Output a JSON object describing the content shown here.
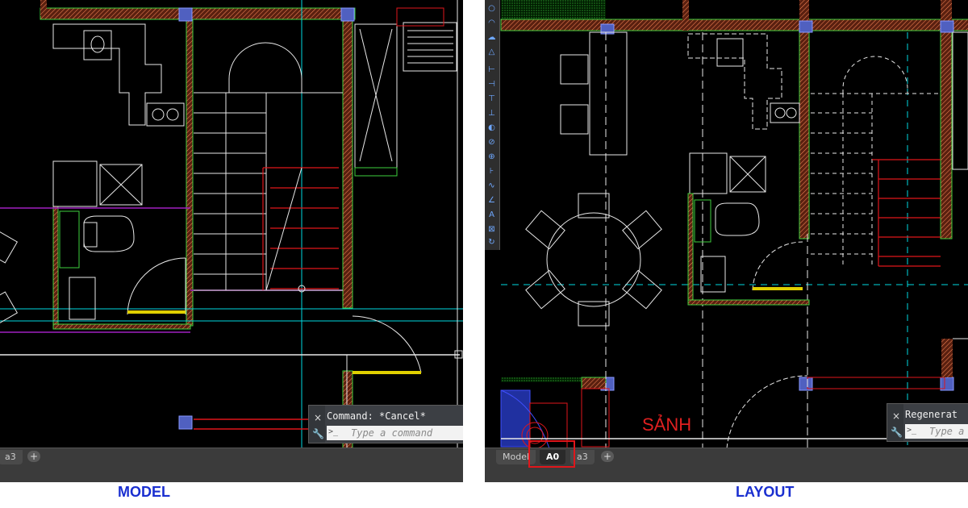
{
  "captions": {
    "model": "MODEL",
    "layout": "LAYOUT"
  },
  "model_panel": {
    "tabs": [
      {
        "label": "a3"
      }
    ],
    "add_tab": "+",
    "command": {
      "history": "Command: *Cancel*",
      "placeholder": "Type a command",
      "close_icon": "×",
      "settings_icon": "🔧",
      "prompt_icon": ">_"
    }
  },
  "layout_panel": {
    "tabs": [
      {
        "label": "Model"
      },
      {
        "label": "A0",
        "active": true
      },
      {
        "label": "a3"
      }
    ],
    "add_tab": "+",
    "command": {
      "history": "Regenerat",
      "placeholder": "Type a",
      "close_icon": "×",
      "settings_icon": "🔧",
      "prompt_icon": ">_"
    },
    "room_label": "SẢNH"
  },
  "colors": {
    "background": "#000000",
    "wall": "#8b3a1a",
    "wall_hatch": "#ff8c5a",
    "cyan": "#00d8e0",
    "red": "#e0161b",
    "green": "#3ecf3e",
    "white": "#e8e8e8",
    "purple": "#a020c0",
    "caption_blue": "#1a2fd0"
  }
}
